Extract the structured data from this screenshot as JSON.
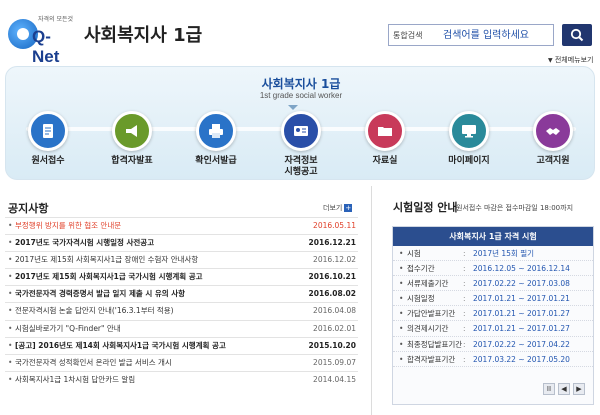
{
  "header": {
    "logo_small": "자격의 모든것",
    "logo_text": "Q-Net",
    "title": "사회복지사 1급",
    "search_type": "통합검색",
    "search_placeholder": "검색어를 입력하세요",
    "sitemap": "전체메뉴보기"
  },
  "nav": {
    "title": "사회복지사 1급",
    "subtitle": "1st grade social worker",
    "items": [
      {
        "label": "원서접수",
        "icon": "document-icon",
        "color": "#2a73c8"
      },
      {
        "label": "합격자발표",
        "icon": "megaphone-icon",
        "color": "#6a9a2a"
      },
      {
        "label": "확인서발급",
        "icon": "printer-icon",
        "color": "#2a73c8"
      },
      {
        "label": "자격정보\n시행공고",
        "icon": "id-card-icon",
        "color": "#2a4fa8"
      },
      {
        "label": "자료실",
        "icon": "folder-icon",
        "color": "#c83a5a"
      },
      {
        "label": "마이페이지",
        "icon": "monitor-icon",
        "color": "#2a8a9a"
      },
      {
        "label": "고객지원",
        "icon": "handshake-icon",
        "color": "#8a3a9a"
      }
    ]
  },
  "notices": {
    "title": "공지사항",
    "more": "더보기",
    "items": [
      {
        "text": "부정행위 방지를 위한 협조 안내문",
        "date": "2016.05.11",
        "style": "hot"
      },
      {
        "text": "2017년도 국가자격시험 시행일정 사전공고",
        "date": "2016.12.21",
        "style": "bold"
      },
      {
        "text": "2017년도 제15회 사회복지사1급 장애인 수험자 안내사항",
        "date": "2016.12.02",
        "style": ""
      },
      {
        "text": "2017년도 제15회 사회복지사1급 국가시험 시행계획 공고",
        "date": "2016.10.21",
        "style": "bold"
      },
      {
        "text": "국가전문자격 경력증명서 발급 일지 제출 시 유의 사항",
        "date": "2016.08.02",
        "style": "bold"
      },
      {
        "text": "전문자격시험 논술 답안지 안내('16.3.1부터 적용)",
        "date": "2016.04.08",
        "style": ""
      },
      {
        "text": "시험실바로가기 \"Q-Finder\" 안내",
        "date": "2016.02.01",
        "style": ""
      },
      {
        "text": "[공고] 2016년도 제14회 사회복지사1급 국가시험 시행계획 공고",
        "date": "2015.10.20",
        "style": "bold"
      },
      {
        "text": "국가전문자격 성적확인서 온라인 발급 서비스 개시",
        "date": "2015.09.07",
        "style": ""
      },
      {
        "text": "사회복지사1급 1차시험 답안카드 알림",
        "date": "2014.04.15",
        "style": ""
      }
    ]
  },
  "schedule": {
    "title": "시험일정 안내",
    "note": "원서접수 마감은 접수마감일 18:00까지",
    "header": "사회복지사 1급 자격 시험",
    "rows": [
      {
        "label": "시험",
        "value": "2017년 15회 필기"
      },
      {
        "label": "접수기간",
        "value": "2016.12.05 ~ 2016.12.14"
      },
      {
        "label": "서류제출기간",
        "value": "2017.02.22 ~ 2017.03.08"
      },
      {
        "label": "시험일정",
        "value": "2017.01.21 ~ 2017.01.21"
      },
      {
        "label": "가답안발표기간",
        "value": "2017.01.21 ~ 2017.01.27"
      },
      {
        "label": "의견제시기간",
        "value": "2017.01.21 ~ 2017.01.27"
      },
      {
        "label": "최종정답발표기간",
        "value": "2017.02.22 ~ 2017.04.22"
      },
      {
        "label": "합격자발표기간",
        "value": "2017.03.22 ~ 2017.05.20"
      }
    ],
    "controls": [
      "II",
      "◀",
      "▶"
    ]
  }
}
